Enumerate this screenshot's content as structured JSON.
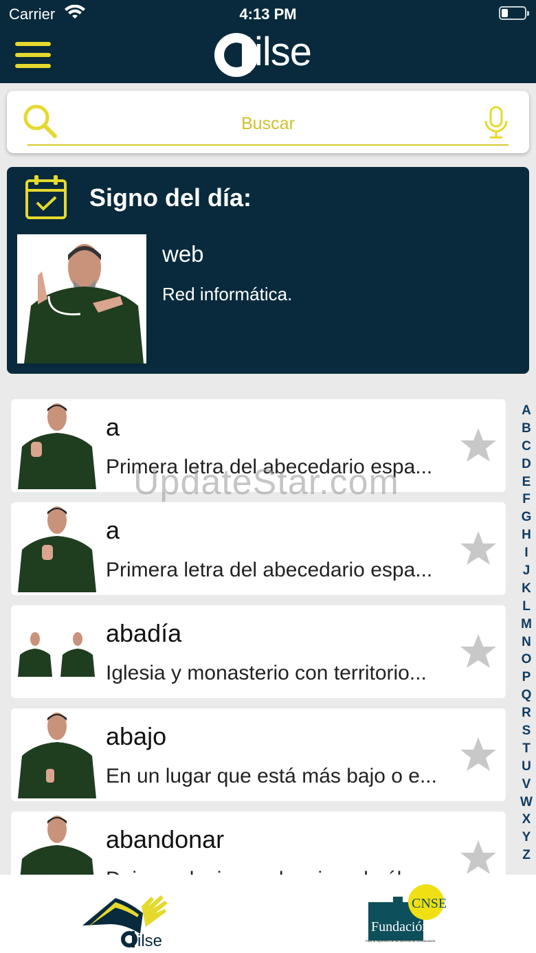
{
  "status": {
    "carrier": "Carrier",
    "time": "4:13 PM"
  },
  "header": {
    "logo_text": "ilse",
    "menu_icon": "hamburger-icon"
  },
  "search": {
    "placeholder": "Buscar",
    "icons": [
      "search-icon",
      "microphone-icon"
    ]
  },
  "sign_of_day": {
    "title": "Signo del día:",
    "word": "web",
    "definition": "Red informática.",
    "icon": "calendar-check-icon"
  },
  "entries": [
    {
      "word": "a",
      "definition": "Primera letra del abecedario espa..."
    },
    {
      "word": "a",
      "definition": "Primera letra del abecedario espa..."
    },
    {
      "word": "abadía",
      "definition": "Iglesia y monasterio con territorio..."
    },
    {
      "word": "abajo",
      "definition": "En un lugar que está más bajo o e..."
    },
    {
      "word": "abandonar",
      "definition": "Dejar a alguien o algo, irse de él..."
    }
  ],
  "alphabet": [
    "A",
    "B",
    "C",
    "D",
    "E",
    "F",
    "G",
    "H",
    "I",
    "J",
    "K",
    "L",
    "M",
    "N",
    "O",
    "P",
    "Q",
    "R",
    "S",
    "T",
    "U",
    "V",
    "W",
    "X",
    "Y",
    "Z"
  ],
  "watermark": "UpdateStar.com",
  "footer": {
    "left_logo_text": "ilse",
    "right_logo_badge": "CNSE",
    "right_logo_text": "Fundación",
    "right_logo_tagline": "Para la supresión de las barreras de comunicación"
  },
  "colors": {
    "navy": "#082a3c",
    "accent_yellow": "#e5d92e",
    "star_gray": "#c8c8c8",
    "index_blue": "#0e3b63"
  }
}
